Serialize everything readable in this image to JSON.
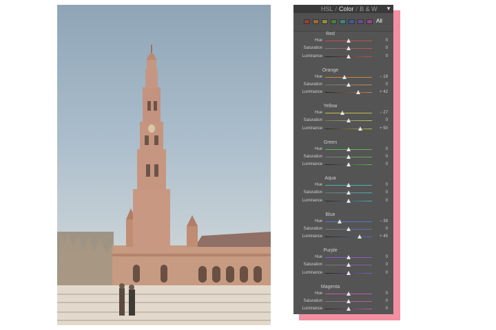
{
  "photo": {
    "alt_label": "Plaza de España tower photo"
  },
  "panel": {
    "tabs": [
      {
        "label": "HSL",
        "active": false
      },
      {
        "label": "Color",
        "active": true
      },
      {
        "label": "B & W",
        "active": false
      }
    ],
    "tab_separator": "/",
    "collapse_glyph": "▼",
    "swatch_all_label": "All",
    "swatches": [
      {
        "name": "red",
        "color": "#8e3f3f"
      },
      {
        "name": "orange",
        "color": "#9a6a36"
      },
      {
        "name": "yellow",
        "color": "#8f8c3b"
      },
      {
        "name": "green",
        "color": "#467d44"
      },
      {
        "name": "aqua",
        "color": "#3f8484"
      },
      {
        "name": "blue",
        "color": "#3f5a97"
      },
      {
        "name": "purple",
        "color": "#6b4b93"
      },
      {
        "name": "magenta",
        "color": "#94457f"
      }
    ],
    "groups": [
      {
        "name": "Red",
        "accent": "#c85050",
        "rows": [
          {
            "label": "Hue",
            "value": "0",
            "pos": 0.5
          },
          {
            "label": "Saturation",
            "value": "0",
            "pos": 0.5
          },
          {
            "label": "Luminance",
            "value": "0",
            "pos": 0.5
          }
        ]
      },
      {
        "name": "Orange",
        "accent": "#c88a40",
        "rows": [
          {
            "label": "Hue",
            "value": "− 19",
            "pos": 0.41
          },
          {
            "label": "Saturation",
            "value": "0",
            "pos": 0.5
          },
          {
            "label": "Luminance",
            "value": "+ 42",
            "pos": 0.71
          }
        ]
      },
      {
        "name": "Yellow",
        "accent": "#c6c04a",
        "rows": [
          {
            "label": "Hue",
            "value": "− 27",
            "pos": 0.37
          },
          {
            "label": "Saturation",
            "value": "0",
            "pos": 0.5
          },
          {
            "label": "Luminance",
            "value": "+ 50",
            "pos": 0.75
          }
        ]
      },
      {
        "name": "Green",
        "accent": "#5cb85a",
        "rows": [
          {
            "label": "Hue",
            "value": "0",
            "pos": 0.5
          },
          {
            "label": "Saturation",
            "value": "0",
            "pos": 0.5
          },
          {
            "label": "Luminance",
            "value": "0",
            "pos": 0.5
          }
        ]
      },
      {
        "name": "Aqua",
        "accent": "#4cb3b3",
        "rows": [
          {
            "label": "Hue",
            "value": "0",
            "pos": 0.5
          },
          {
            "label": "Saturation",
            "value": "0",
            "pos": 0.5
          },
          {
            "label": "Luminance",
            "value": "0",
            "pos": 0.5
          }
        ]
      },
      {
        "name": "Blue",
        "accent": "#5576c8",
        "rows": [
          {
            "label": "Hue",
            "value": "− 39",
            "pos": 0.31
          },
          {
            "label": "Saturation",
            "value": "0",
            "pos": 0.5
          },
          {
            "label": "Luminance",
            "value": "+ 45",
            "pos": 0.73
          }
        ]
      },
      {
        "name": "Purple",
        "accent": "#8b5cc8",
        "rows": [
          {
            "label": "Hue",
            "value": "0",
            "pos": 0.5
          },
          {
            "label": "Saturation",
            "value": "0",
            "pos": 0.5
          },
          {
            "label": "Luminance",
            "value": "0",
            "pos": 0.5
          }
        ]
      },
      {
        "name": "Magenta",
        "accent": "#c458a8",
        "rows": [
          {
            "label": "Hue",
            "value": "0",
            "pos": 0.5
          },
          {
            "label": "Saturation",
            "value": "0",
            "pos": 0.5
          },
          {
            "label": "Luminance",
            "value": "0",
            "pos": 0.5
          }
        ]
      }
    ]
  }
}
